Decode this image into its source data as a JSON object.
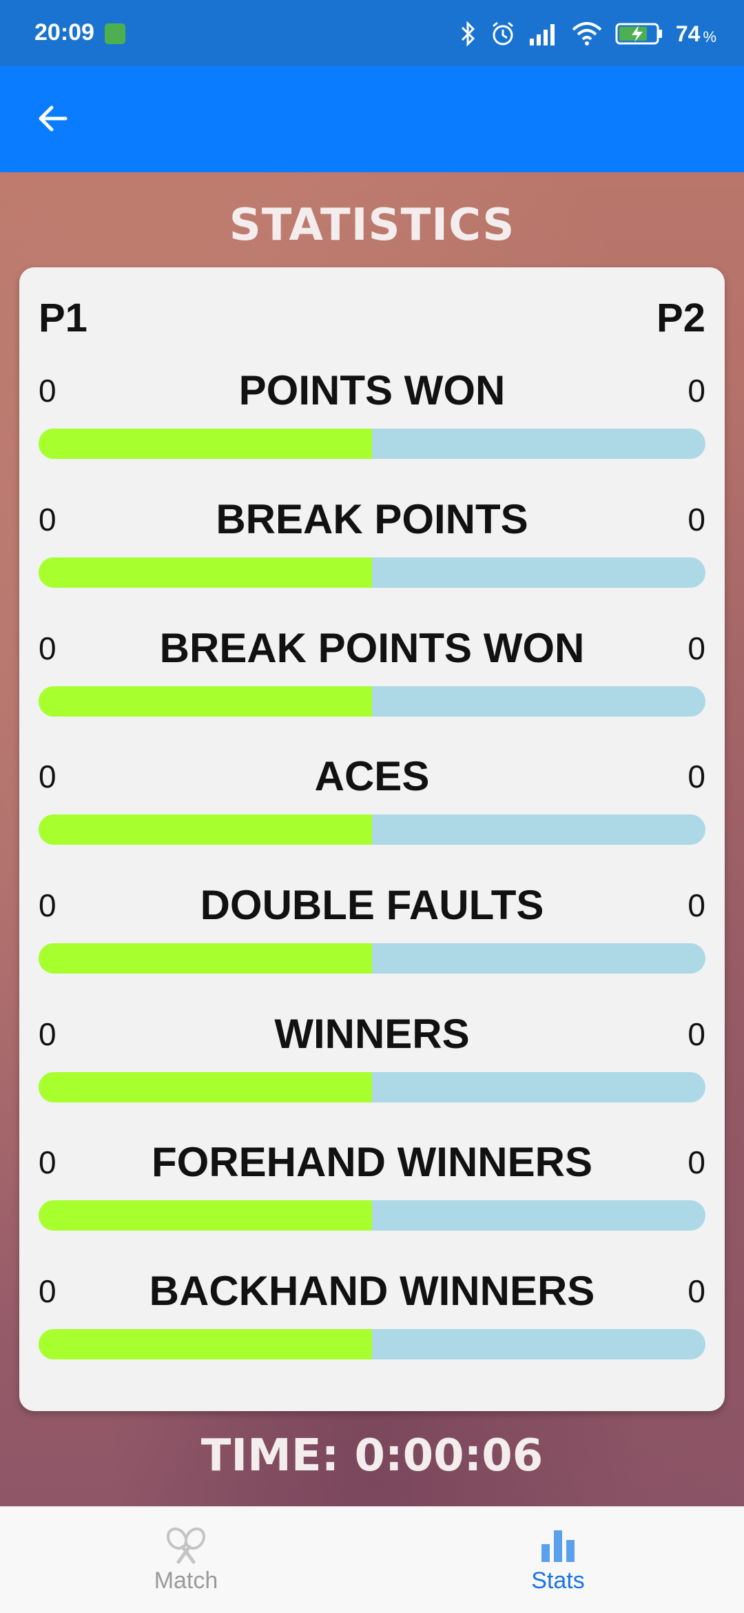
{
  "status_bar": {
    "time": "20:09",
    "battery": "74",
    "battery_unit": "%"
  },
  "screen": {
    "title": "STATISTICS",
    "timer": "TIME: 0:00:06"
  },
  "card": {
    "p1_header": "P1",
    "p2_header": "P2"
  },
  "stats": [
    {
      "label": "POINTS WON",
      "p1": "0",
      "p2": "0",
      "p1_share": 0.5
    },
    {
      "label": "BREAK POINTS",
      "p1": "0",
      "p2": "0",
      "p1_share": 0.5
    },
    {
      "label": "BREAK POINTS WON",
      "p1": "0",
      "p2": "0",
      "p1_share": 0.5
    },
    {
      "label": "ACES",
      "p1": "0",
      "p2": "0",
      "p1_share": 0.5
    },
    {
      "label": "DOUBLE FAULTS",
      "p1": "0",
      "p2": "0",
      "p1_share": 0.5
    },
    {
      "label": "WINNERS",
      "p1": "0",
      "p2": "0",
      "p1_share": 0.5
    },
    {
      "label": "FOREHAND WINNERS",
      "p1": "0",
      "p2": "0",
      "p1_share": 0.5
    },
    {
      "label": "BACKHAND WINNERS",
      "p1": "0",
      "p2": "0",
      "p1_share": 0.5
    }
  ],
  "bottom_nav": {
    "items": [
      {
        "label": "Match",
        "icon": "tennis-rackets-icon",
        "active": false
      },
      {
        "label": "Stats",
        "icon": "bar-chart-icon",
        "active": true
      }
    ]
  },
  "colors": {
    "app_bar": "#0a7cff",
    "status_bar": "#1a73d0",
    "p1_bar": "#a7ff2e",
    "p2_bar": "#add8e6",
    "active_nav": "#1a73e8"
  }
}
